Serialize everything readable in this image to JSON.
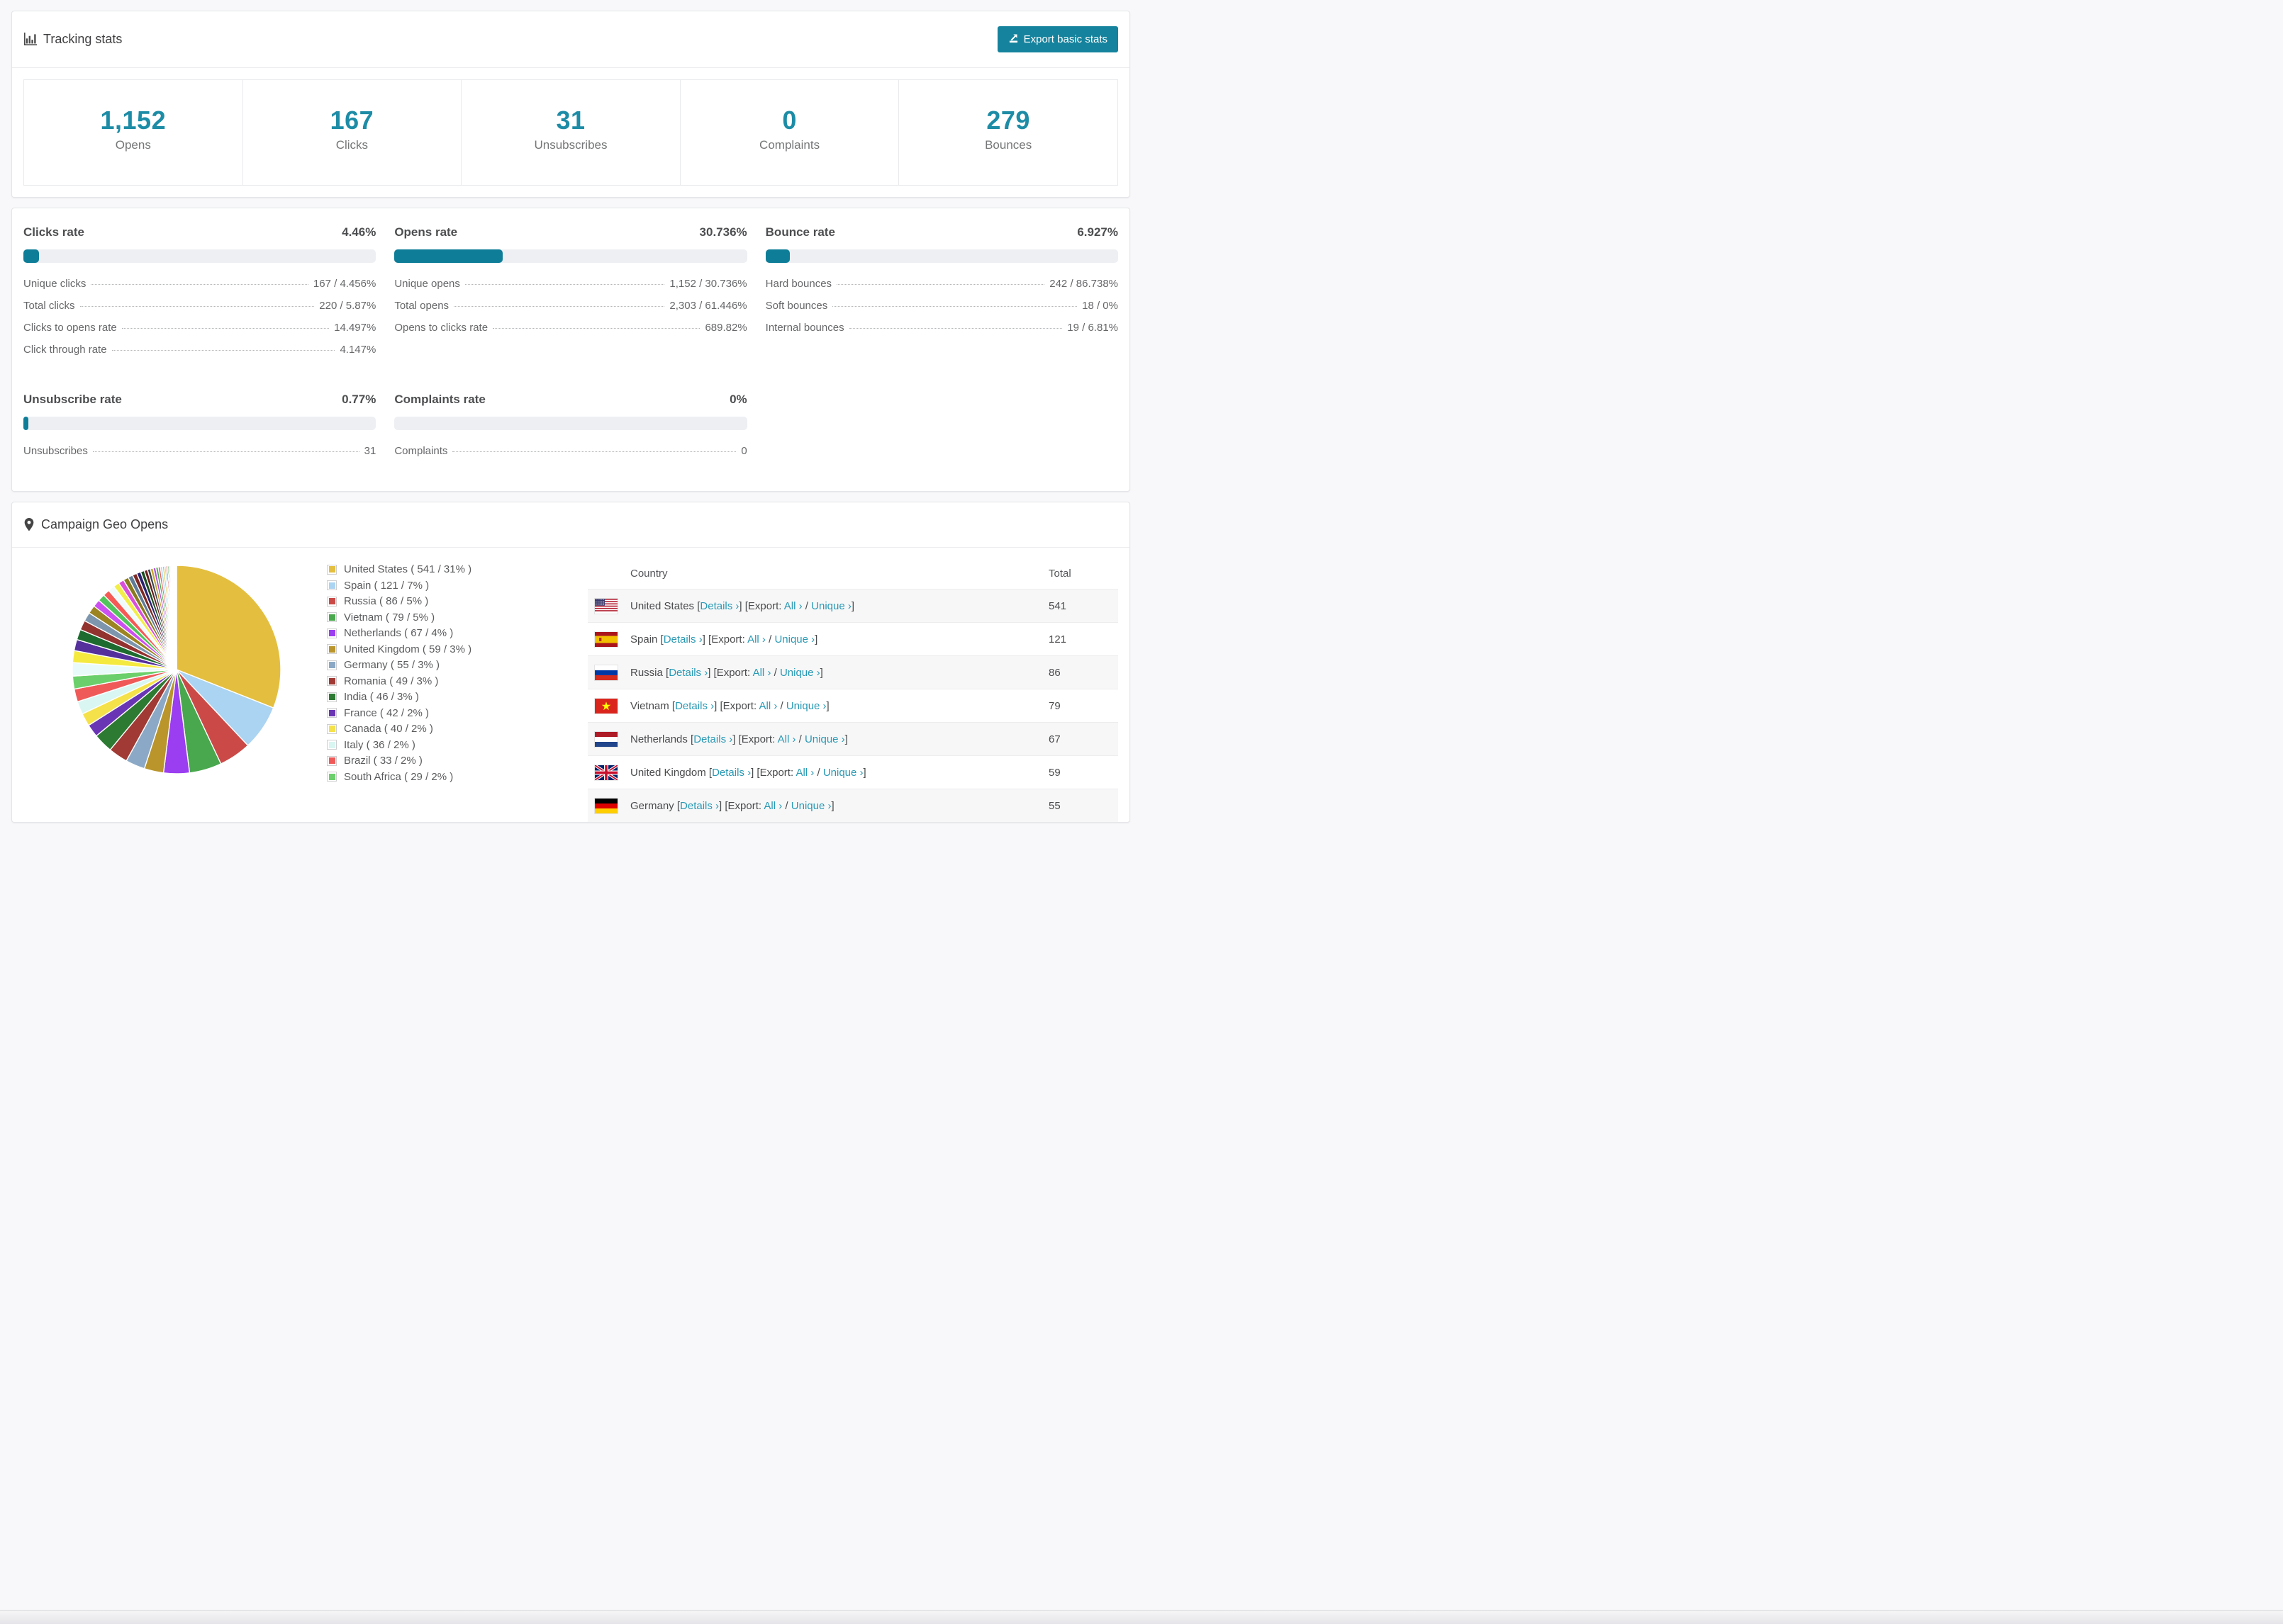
{
  "colors": {
    "accent_teal": "#15839d",
    "stat_number_teal": "#1d8ca6",
    "bar_fill": "#0e7e98",
    "bar_track": "#edeff3",
    "link_teal": "#2899b4"
  },
  "tracking": {
    "title": "Tracking stats",
    "export_button": "Export basic stats",
    "stats": [
      {
        "value": "1,152",
        "label": "Opens"
      },
      {
        "value": "167",
        "label": "Clicks"
      },
      {
        "value": "31",
        "label": "Unsubscribes"
      },
      {
        "value": "0",
        "label": "Complaints"
      },
      {
        "value": "279",
        "label": "Bounces"
      }
    ]
  },
  "rates": [
    {
      "title": "Clicks rate",
      "value": "4.46%",
      "percent": 4.46,
      "rows": [
        {
          "label": "Unique clicks",
          "value": "167 / 4.456%"
        },
        {
          "label": "Total clicks",
          "value": "220 / 5.87%"
        },
        {
          "label": "Clicks to opens rate",
          "value": "14.497%"
        },
        {
          "label": "Click through rate",
          "value": "4.147%"
        }
      ]
    },
    {
      "title": "Opens rate",
      "value": "30.736%",
      "percent": 30.736,
      "rows": [
        {
          "label": "Unique opens",
          "value": "1,152 / 30.736%"
        },
        {
          "label": "Total opens",
          "value": "2,303 / 61.446%"
        },
        {
          "label": "Opens to clicks rate",
          "value": "689.82%"
        }
      ]
    },
    {
      "title": "Bounce rate",
      "value": "6.927%",
      "percent": 6.927,
      "rows": [
        {
          "label": "Hard bounces",
          "value": "242 / 86.738%"
        },
        {
          "label": "Soft bounces",
          "value": "18 / 0%"
        },
        {
          "label": "Internal bounces",
          "value": "19 / 6.81%"
        }
      ]
    },
    {
      "title": "Unsubscribe rate",
      "value": "0.77%",
      "percent": 0.77,
      "rows": [
        {
          "label": "Unsubscribes",
          "value": "31"
        }
      ]
    },
    {
      "title": "Complaints rate",
      "value": "0%",
      "percent": 0,
      "rows": [
        {
          "label": "Complaints",
          "value": "0"
        }
      ]
    }
  ],
  "geo": {
    "title": "Campaign Geo Opens",
    "chart_data": {
      "type": "pie",
      "title": "Campaign Geo Opens",
      "legend_position": "right",
      "start_angle_deg": -90,
      "direction": "clockwise",
      "series": [
        {
          "name": "United States",
          "value": 541,
          "pct": 31,
          "color": "#e4bf3f"
        },
        {
          "name": "Spain",
          "value": 121,
          "pct": 7,
          "color": "#abd3f2"
        },
        {
          "name": "Russia",
          "value": 86,
          "pct": 5,
          "color": "#cb4a47"
        },
        {
          "name": "Vietnam",
          "value": 79,
          "pct": 5,
          "color": "#49a84d"
        },
        {
          "name": "Netherlands",
          "value": 67,
          "pct": 4,
          "color": "#9b3df0"
        },
        {
          "name": "United Kingdom",
          "value": 59,
          "pct": 3,
          "color": "#b9952c"
        },
        {
          "name": "Germany",
          "value": 55,
          "pct": 3,
          "color": "#8ba9c6"
        },
        {
          "name": "Romania",
          "value": 49,
          "pct": 3,
          "color": "#a13a34"
        },
        {
          "name": "India",
          "value": 46,
          "pct": 3,
          "color": "#2d7a33"
        },
        {
          "name": "France",
          "value": 42,
          "pct": 2,
          "color": "#6a35b5"
        },
        {
          "name": "Canada",
          "value": 40,
          "pct": 2,
          "color": "#f5e14a"
        },
        {
          "name": "Italy",
          "value": 36,
          "pct": 2,
          "color": "#d9f6f2"
        },
        {
          "name": "Brazil",
          "value": 33,
          "pct": 2,
          "color": "#ef5a58"
        },
        {
          "name": "South Africa",
          "value": 29,
          "pct": 2,
          "color": "#6bd06b"
        }
      ],
      "legend_format": {
        "open": " ( ",
        "sep": " / ",
        "close": "% )"
      },
      "others_unlabeled_slices": {
        "total_pct": 26,
        "weights": [
          1.8,
          1.6,
          1.5,
          1.4,
          1.3,
          1.2,
          1.1,
          1.0,
          0.95,
          0.9,
          0.85,
          0.8,
          0.75,
          0.7,
          0.65,
          0.6,
          0.55,
          0.5,
          0.45,
          0.4,
          0.38,
          0.35,
          0.32,
          0.3,
          0.28,
          0.25,
          0.22,
          0.2,
          0.18,
          0.16,
          0.14,
          0.12,
          0.11,
          0.1,
          0.09,
          0.08,
          0.07,
          0.06,
          0.05,
          0.05
        ],
        "colors": [
          "#e8fbfa",
          "#f4e93f",
          "#55309c",
          "#1e6b30",
          "#933330",
          "#7d96ad",
          "#9c8422",
          "#cc4ff0",
          "#52c45c",
          "#f55a55",
          "#effcfb",
          "#f2ee49",
          "#d94fd9",
          "#8a7a1e",
          "#5f7c96",
          "#7e2a24",
          "#2b2370",
          "#1b4f22",
          "#6b1f1c",
          "#3c4650",
          "#c8a52c",
          "#b04fe0",
          "#44b04c",
          "#f06060",
          "#9adbf5",
          "#e0c23a",
          "#a8d4f0",
          "#d04343",
          "#3fa04a",
          "#8a3fd0",
          "#e050e0",
          "#caa228",
          "#74b8e8",
          "#e85050",
          "#50c050",
          "#a050e0",
          "#f0a0d0",
          "#d0b840",
          "#90c8f0",
          "#e87070"
        ]
      }
    },
    "table": {
      "headers": {
        "country": "Country",
        "total": "Total"
      },
      "labels": {
        "bracket_open": "[",
        "bracket_close": "]",
        "details": "Details ›",
        "export_word": "Export:",
        "all": "All ›",
        "slash": "/",
        "unique": "Unique ›"
      },
      "rows": [
        {
          "country": "United States",
          "flag": "us",
          "total": "541"
        },
        {
          "country": "Spain",
          "flag": "es",
          "total": "121"
        },
        {
          "country": "Russia",
          "flag": "ru",
          "total": "86"
        },
        {
          "country": "Vietnam",
          "flag": "vn",
          "total": "79"
        },
        {
          "country": "Netherlands",
          "flag": "nl",
          "total": "67"
        },
        {
          "country": "United Kingdom",
          "flag": "gb",
          "total": "59"
        },
        {
          "country": "Germany",
          "flag": "de",
          "total": "55"
        }
      ]
    }
  }
}
